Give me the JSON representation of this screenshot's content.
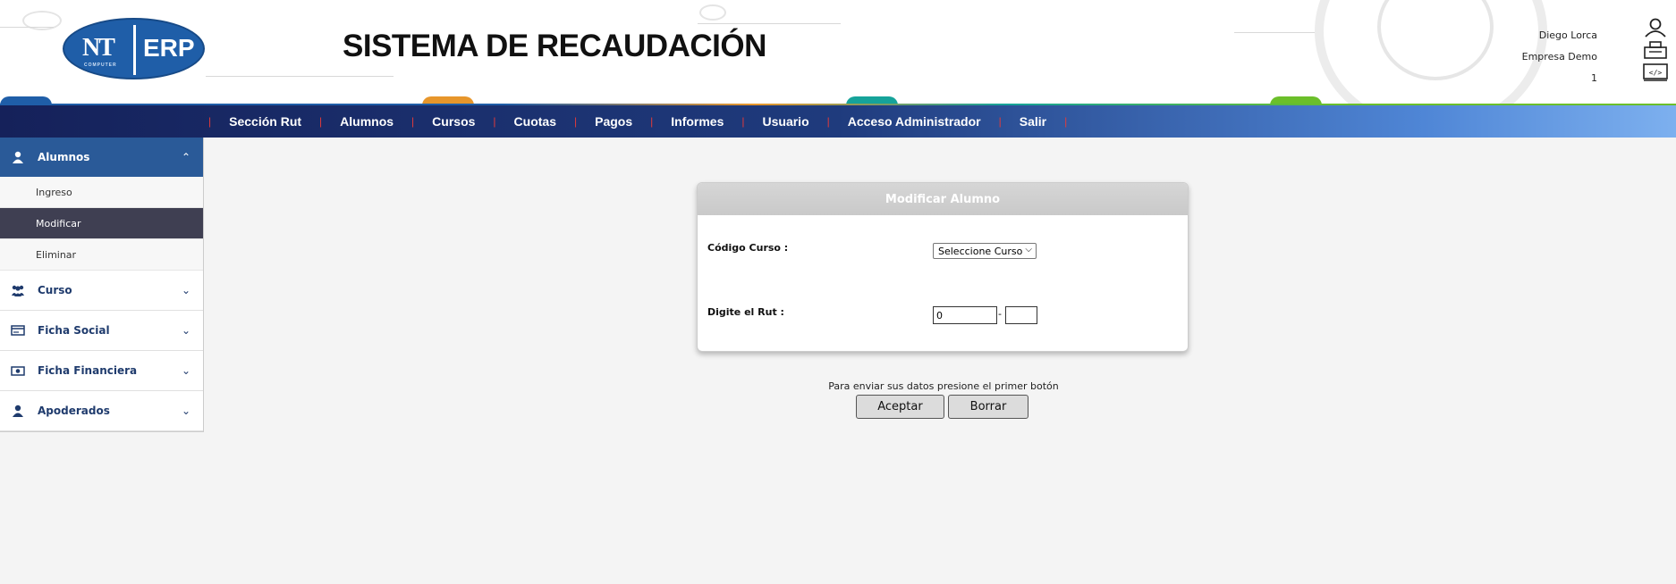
{
  "header": {
    "logo_text_left": "NT",
    "logo_subtext": "COMPUTER",
    "logo_text_right": "ERP",
    "title": "SISTEMA DE RECAUDACIÓN",
    "user_name": "Diego Lorca",
    "company": "Empresa Demo",
    "number": "1",
    "icons": [
      "user-icon",
      "company-icon",
      "code-icon"
    ]
  },
  "nav": {
    "items": [
      "Sección Rut",
      "Alumnos",
      "Cursos",
      "Cuotas",
      "Pagos",
      "Informes",
      "Usuario",
      "Acceso Administrador",
      "Salir"
    ]
  },
  "sidebar": {
    "active_section": {
      "label": "Alumnos",
      "icon": "user-icon",
      "items": [
        "Ingreso",
        "Modificar",
        "Eliminar"
      ],
      "active_item": "Modificar"
    },
    "sections": [
      {
        "label": "Curso",
        "icon": "group-icon"
      },
      {
        "label": "Ficha Social",
        "icon": "card-icon"
      },
      {
        "label": "Ficha Financiera",
        "icon": "money-icon"
      },
      {
        "label": "Apoderados",
        "icon": "user-icon"
      }
    ]
  },
  "form": {
    "title": "Modificar Alumno",
    "codigo_label": "Código Curso :",
    "select_value": "Seleccione Curso",
    "rut_label": "Digite el Rut :",
    "rut_value": "0",
    "rut_separator": "-",
    "dv_value": "",
    "helper_text": "Para enviar sus datos presione el primer botón",
    "accept_label": "Aceptar",
    "clear_label": "Borrar"
  },
  "colors": {
    "nav_start": "#15215a",
    "nav_end": "#7db0ef",
    "sidebar_head": "#2a5a98",
    "active_item": "#3f3f52",
    "logo": "#1f5ea8"
  }
}
